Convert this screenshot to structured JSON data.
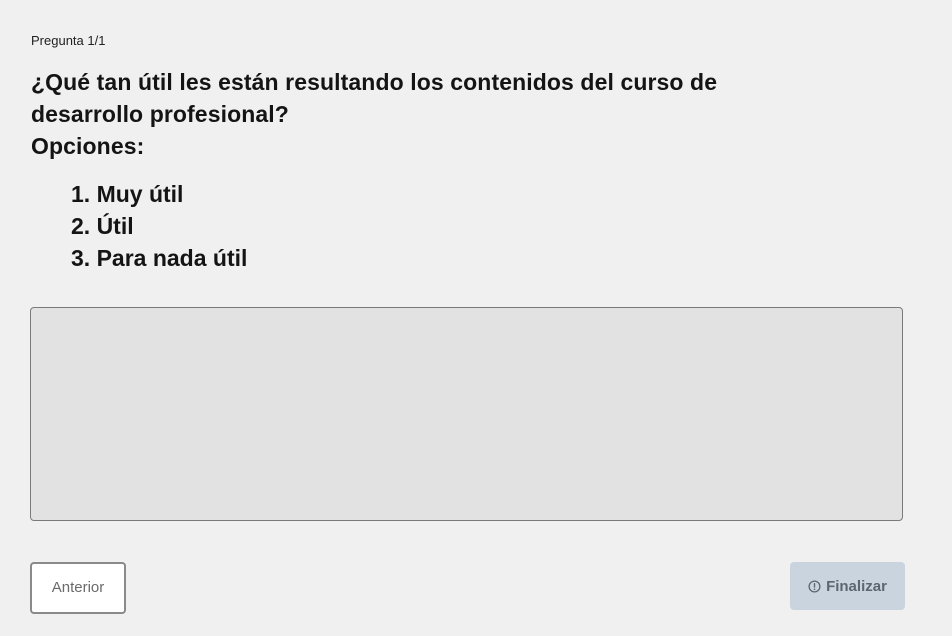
{
  "question": {
    "counter": "Pregunta 1/1",
    "text_line1": "¿Qué tan útil les están resultando los contenidos del curso de",
    "text_line2": "desarrollo profesional?",
    "options_heading": "Opciones:",
    "options": [
      "1. Muy útil",
      "2. Útil",
      "3. Para nada útil"
    ]
  },
  "answer": {
    "value": "",
    "placeholder": ""
  },
  "nav": {
    "prev_label": "Anterior",
    "finish_label": "Finalizar",
    "finish_icon": "alert-circle-icon",
    "finish_disabled": true
  },
  "colors": {
    "background": "#f0f0f0",
    "answer_box": "#e2e2e2",
    "finish_button": "#c9d4df"
  }
}
